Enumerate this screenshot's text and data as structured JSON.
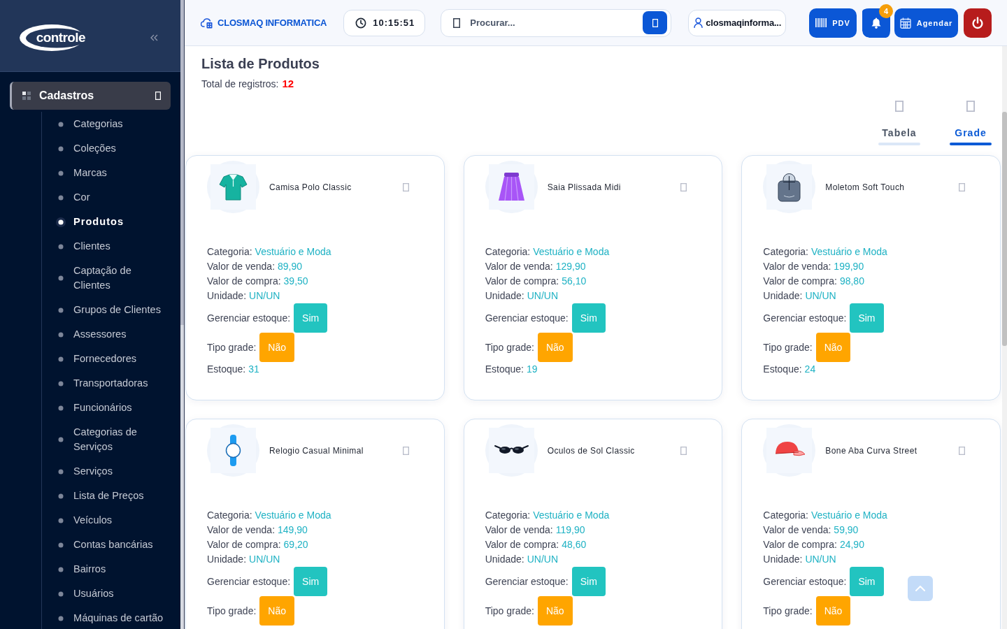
{
  "sidebar": {
    "logo": "controle",
    "menu": {
      "label": "Cadastros",
      "expanded": true,
      "children": [
        {
          "label": "Categorias",
          "selected": false
        },
        {
          "label": "Coleções",
          "selected": false
        },
        {
          "label": "Marcas",
          "selected": false
        },
        {
          "label": "Cor",
          "selected": false
        },
        {
          "label": "Produtos",
          "selected": true
        },
        {
          "label": "Clientes",
          "selected": false
        },
        {
          "label": "Captação de Clientes",
          "selected": false
        },
        {
          "label": "Grupos de Clientes",
          "selected": false
        },
        {
          "label": "Assessores",
          "selected": false
        },
        {
          "label": "Fornecedores",
          "selected": false
        },
        {
          "label": "Transportadoras",
          "selected": false
        },
        {
          "label": "Funcionários",
          "selected": false
        },
        {
          "label": "Categorias de Serviços",
          "selected": false
        },
        {
          "label": "Serviços",
          "selected": false
        },
        {
          "label": "Lista de Preços",
          "selected": false
        },
        {
          "label": "Veículos",
          "selected": false
        },
        {
          "label": "Contas bancárias",
          "selected": false
        },
        {
          "label": "Bairros",
          "selected": false
        },
        {
          "label": "Usuários",
          "selected": false
        },
        {
          "label": "Máquinas de cartão",
          "selected": false
        }
      ]
    }
  },
  "topbar": {
    "company": "CLOSMAQ INFORMATICA",
    "clock": "10:15:51",
    "search": {
      "placeholder": "Procurar..."
    },
    "user": "closmaqinforma...",
    "actions": [
      {
        "kind": "pdv",
        "label": "PDV"
      },
      {
        "kind": "notifications",
        "badge": "4"
      },
      {
        "kind": "schedule",
        "label": "Agendar"
      },
      {
        "kind": "logout"
      }
    ]
  },
  "page": {
    "title": "Lista de Produtos",
    "total_label": "Total de registros:",
    "total": "12"
  },
  "view_tabs": [
    {
      "label": "Tabela",
      "selected": false
    },
    {
      "label": "Grade",
      "selected": true
    }
  ],
  "products": [
    {
      "name": "Camisa Polo Classic",
      "fields": [
        {
          "label": "Categoria:",
          "value": "Vestuário e Moda"
        },
        {
          "label": "Valor de venda:",
          "value": "89,90"
        },
        {
          "label": "Valor de compra:",
          "value": "39,50"
        },
        {
          "label": "Unidade:",
          "value": "UN/UN"
        }
      ],
      "flags": [
        {
          "label": "Gerenciar estoque:",
          "value": "Sim",
          "on": true
        },
        {
          "label": "Tipo grade:",
          "value": "Não",
          "on": false
        }
      ],
      "stock": {
        "label": "Estoque:",
        "value": "31"
      }
    },
    {
      "name": "Saia Plissada Midi",
      "fields": [
        {
          "label": "Categoria:",
          "value": "Vestuário e Moda"
        },
        {
          "label": "Valor de venda:",
          "value": "129,90"
        },
        {
          "label": "Valor de compra:",
          "value": "56,10"
        },
        {
          "label": "Unidade:",
          "value": "UN/UN"
        }
      ],
      "flags": [
        {
          "label": "Gerenciar estoque:",
          "value": "Sim",
          "on": true
        },
        {
          "label": "Tipo grade:",
          "value": "Não",
          "on": false
        }
      ],
      "stock": {
        "label": "Estoque:",
        "value": "19"
      }
    },
    {
      "name": "Moletom Soft Touch",
      "fields": [
        {
          "label": "Categoria:",
          "value": "Vestuário e Moda"
        },
        {
          "label": "Valor de venda:",
          "value": "199,90"
        },
        {
          "label": "Valor de compra:",
          "value": "98,80"
        },
        {
          "label": "Unidade:",
          "value": "UN/UN"
        }
      ],
      "flags": [
        {
          "label": "Gerenciar estoque:",
          "value": "Sim",
          "on": true
        },
        {
          "label": "Tipo grade:",
          "value": "Não",
          "on": false
        }
      ],
      "stock": {
        "label": "Estoque:",
        "value": "24"
      }
    },
    {
      "name": "Relogio Casual Minimal",
      "fields": [
        {
          "label": "Categoria:",
          "value": "Vestuário e Moda"
        },
        {
          "label": "Valor de venda:",
          "value": "149,90"
        },
        {
          "label": "Valor de compra:",
          "value": "69,20"
        },
        {
          "label": "Unidade:",
          "value": "UN/UN"
        }
      ],
      "flags": [
        {
          "label": "Gerenciar estoque:",
          "value": "Sim",
          "on": true
        },
        {
          "label": "Tipo grade:",
          "value": "Não",
          "on": false
        }
      ]
    },
    {
      "name": "Oculos de Sol Classic",
      "fields": [
        {
          "label": "Categoria:",
          "value": "Vestuário e Moda"
        },
        {
          "label": "Valor de venda:",
          "value": "119,90"
        },
        {
          "label": "Valor de compra:",
          "value": "48,60"
        },
        {
          "label": "Unidade:",
          "value": "UN/UN"
        }
      ],
      "flags": [
        {
          "label": "Gerenciar estoque:",
          "value": "Sim",
          "on": true
        },
        {
          "label": "Tipo grade:",
          "value": "Não",
          "on": false
        }
      ]
    },
    {
      "name": "Bone Aba Curva Street",
      "fields": [
        {
          "label": "Categoria:",
          "value": "Vestuário e Moda"
        },
        {
          "label": "Valor de venda:",
          "value": "59,90"
        },
        {
          "label": "Valor de compra:",
          "value": "24,90"
        },
        {
          "label": "Unidade:",
          "value": "UN/UN"
        }
      ],
      "flags": [
        {
          "label": "Gerenciar estoque:",
          "value": "Sim",
          "on": true
        },
        {
          "label": "Tipo grade:",
          "value": "Não",
          "on": false
        }
      ]
    }
  ]
}
